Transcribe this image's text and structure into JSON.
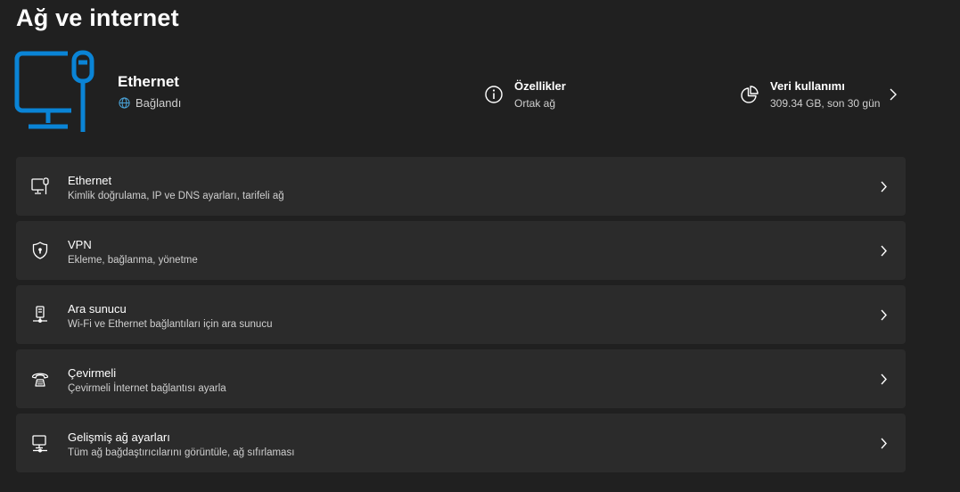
{
  "page": {
    "title": "Ağ ve internet"
  },
  "hero": {
    "icon": "ethernet-monitor-icon",
    "accent": "#0a84d6",
    "name": "Ethernet",
    "status": "Bağlandı",
    "status_icon": "globe-icon",
    "properties": {
      "title": "Özellikler",
      "subtitle": "Ortak ağ",
      "icon": "info-icon"
    },
    "usage": {
      "title": "Veri kullanımı",
      "subtitle": "309.34 GB, son 30 gün",
      "icon": "pie-chart-icon"
    }
  },
  "items": [
    {
      "title": "Ethernet",
      "subtitle": "Kimlik doğrulama, IP ve DNS ayarları, tarifeli ağ",
      "icon": "ethernet-icon"
    },
    {
      "title": "VPN",
      "subtitle": "Ekleme, bağlanma, yönetme",
      "icon": "vpn-shield-icon"
    },
    {
      "title": "Ara sunucu",
      "subtitle": "Wi-Fi ve Ethernet bağlantıları için ara sunucu",
      "icon": "proxy-icon"
    },
    {
      "title": "Çevirmeli",
      "subtitle": "Çevirmeli İnternet bağlantısı ayarla",
      "icon": "dial-up-icon"
    },
    {
      "title": "Gelişmiş ağ ayarları",
      "subtitle": "Tüm ağ bağdaştırıcılarını görüntüle, ağ sıfırlaması",
      "icon": "advanced-network-icon"
    }
  ],
  "colors": {
    "background": "#202020",
    "card": "#2b2b2b",
    "accent": "#0a84d6",
    "status_globe": "#4aa3d8"
  }
}
